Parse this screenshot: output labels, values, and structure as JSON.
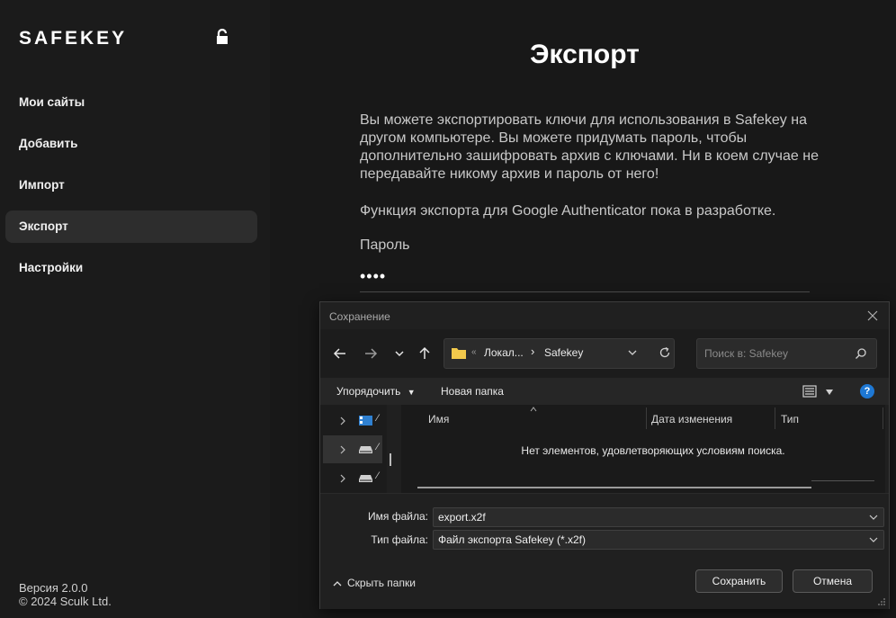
{
  "sidebar": {
    "logo": "SAFEKEY",
    "nav_items": [
      {
        "label": "Мои сайты",
        "active": false
      },
      {
        "label": "Добавить",
        "active": false
      },
      {
        "label": "Импорт",
        "active": false
      },
      {
        "label": "Экспорт",
        "active": true
      },
      {
        "label": "Настройки",
        "active": false
      }
    ],
    "version": "Версия 2.0.0",
    "copyright": "© 2024 Sculk Ltd."
  },
  "main": {
    "title": "Экспорт",
    "description": "Вы можете экспортировать ключи для использования в Safekey на другом компьютере. Вы можете придумать пароль, чтобы дополнительно зашифровать архив с ключами. Ни в коем случае не передавайте никому архив и пароль от него!",
    "google_note": "Функция экспорта для Google Authenticator пока в разработке.",
    "password_label": "Пароль",
    "password_value": "••••"
  },
  "dialog": {
    "title": "Сохранение",
    "address": {
      "chevrons": "«",
      "segment1": "Локал...",
      "separator": "›",
      "segment2": "Safekey"
    },
    "search_placeholder": "Поиск в: Safekey",
    "toolbar": {
      "sort": "Упорядочить",
      "new_folder": "Новая папка",
      "help": "?"
    },
    "tree_items": [
      {
        "label": "⁄",
        "icon": "desktop-icon",
        "selected": false
      },
      {
        "label": "⁄",
        "icon": "drive-icon",
        "selected": true
      },
      {
        "label": "⁄",
        "icon": "drive-icon",
        "selected": false
      }
    ],
    "columns": {
      "name": "Имя",
      "date": "Дата изменения",
      "type": "Тип"
    },
    "empty_message": "Нет элементов, удовлетворяющих условиям поиска.",
    "filename_label": "Имя файла:",
    "filename_value": "export.x2f",
    "filetype_label": "Тип файла:",
    "filetype_value": "Файл экспорта Safekey (*.x2f)",
    "hide_folders": "Скрыть папки",
    "save_button": "Сохранить",
    "cancel_button": "Отмена"
  },
  "colors": {
    "accent": "#1e78d4",
    "folder": "#f2c94c",
    "background": "#181818"
  }
}
